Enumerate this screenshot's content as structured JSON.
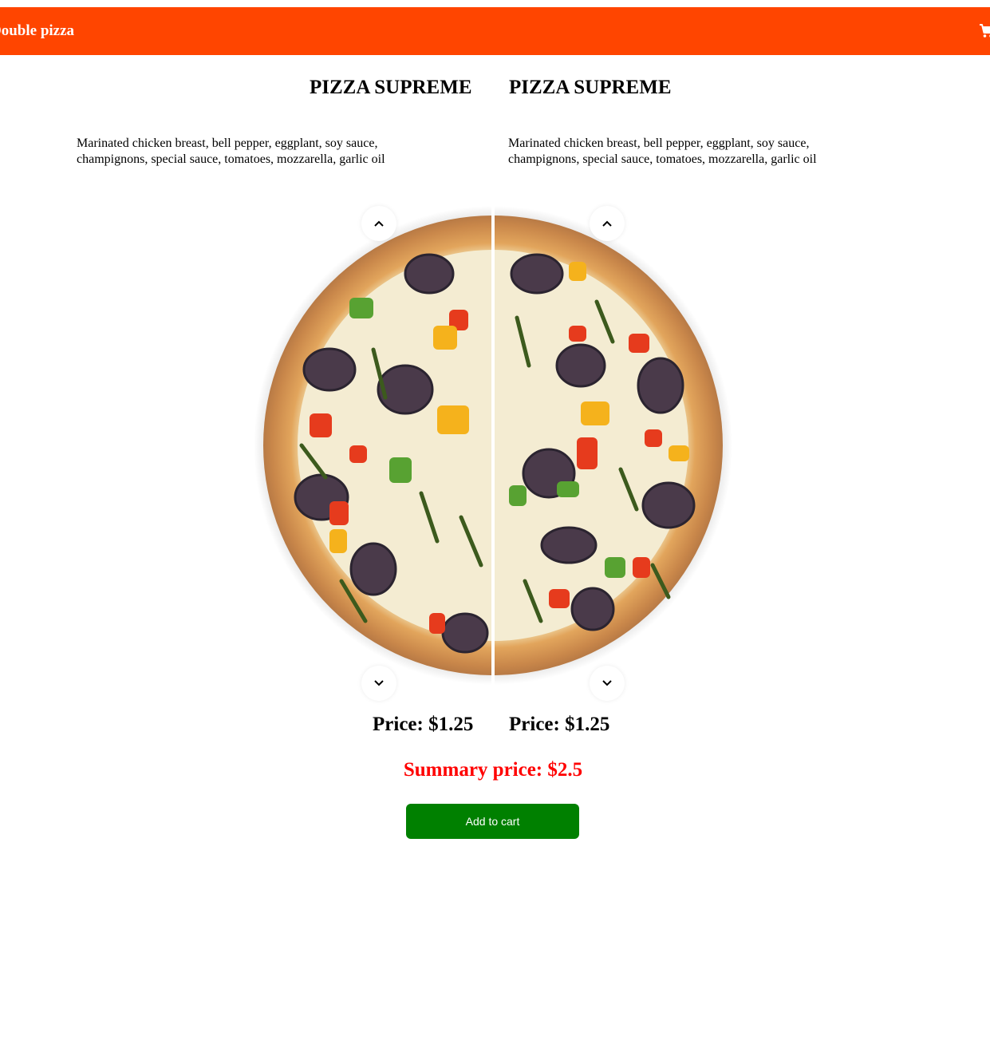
{
  "header": {
    "brand": "Double pizza",
    "cart_icon": "shopping-cart-icon",
    "background_color": "#ff4500"
  },
  "left_pizza": {
    "title": "PIZZA SUPREME",
    "description": "Marinated chicken breast, bell pepper, eggplant, soy sauce, champignons, special sauce, tomatoes, mozzarella, garlic oil",
    "price": "Price: $1.25",
    "up_icon": "chevron-up-icon",
    "down_icon": "chevron-down-icon"
  },
  "right_pizza": {
    "title": "PIZZA SUPREME",
    "description": "Marinated chicken breast, bell pepper, eggplant, soy sauce, champignons, special sauce, tomatoes, mozzarella, garlic oil",
    "price": "Price: $1.25",
    "up_icon": "chevron-up-icon",
    "down_icon": "chevron-down-icon"
  },
  "summary": {
    "text": "Summary price: $2.5",
    "color": "#ff0000"
  },
  "cart_button": {
    "label": "Add to cart",
    "color": "#008000"
  }
}
